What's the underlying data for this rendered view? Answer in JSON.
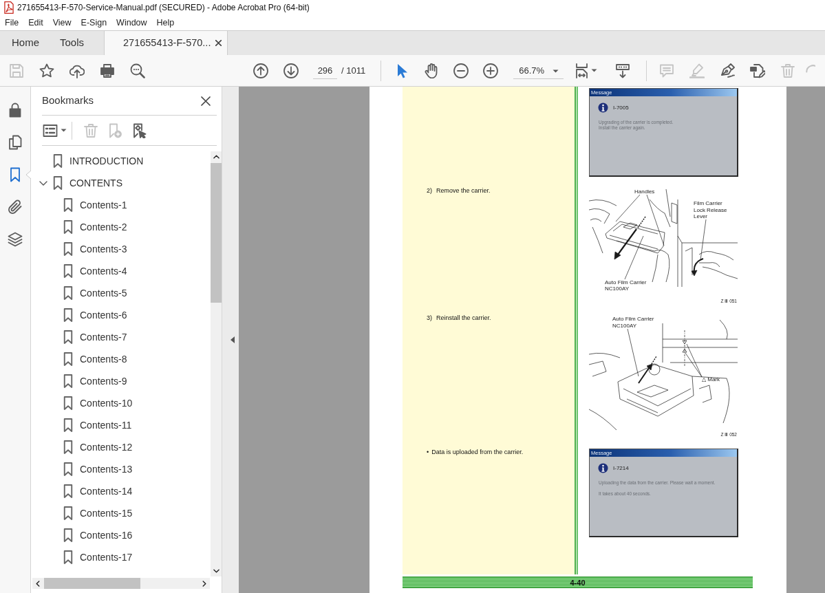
{
  "window": {
    "title": "271655413-F-570-Service-Manual.pdf (SECURED) - Adobe Acrobat Pro (64-bit)"
  },
  "menu": [
    "File",
    "Edit",
    "View",
    "E-Sign",
    "Window",
    "Help"
  ],
  "tabs": [
    {
      "label": "Home",
      "selected": false,
      "closable": false
    },
    {
      "label": "Tools",
      "selected": false,
      "closable": false
    },
    {
      "label": "271655413-F-570...",
      "selected": true,
      "closable": true
    }
  ],
  "toolbar": {
    "file_tools": [
      {
        "kind": "save",
        "disabled": true
      },
      {
        "kind": "star",
        "disabled": false
      },
      {
        "kind": "upload",
        "disabled": false
      },
      {
        "kind": "print",
        "disabled": false
      },
      {
        "kind": "find",
        "disabled": false
      }
    ],
    "page_tools": [
      {
        "kind": "previous"
      },
      {
        "kind": "next"
      }
    ],
    "page_number": "296",
    "page_count": "/ 1011",
    "mode_tools": [
      {
        "kind": "select",
        "selected": true
      },
      {
        "kind": "hand",
        "selected": false
      }
    ],
    "zoom_tools": [
      {
        "kind": "zoom-out"
      },
      {
        "kind": "zoom-in"
      }
    ],
    "zoom": "66.7%",
    "view_tools": [
      {
        "kind": "fit-page"
      },
      {
        "kind": "scroll-mode"
      }
    ],
    "edit_tools": [
      {
        "kind": "comment",
        "disabled": true
      },
      {
        "kind": "highlight",
        "disabled": true
      },
      {
        "kind": "sign",
        "disabled": false
      },
      {
        "kind": "edit-pdf",
        "disabled": false
      },
      {
        "kind": "delete",
        "disabled": true
      },
      {
        "kind": "redo",
        "disabled": true
      }
    ]
  },
  "sidebar": {
    "tools": [
      {
        "kind": "security",
        "selected": false
      },
      {
        "kind": "pages",
        "selected": false
      },
      {
        "kind": "bookmarks",
        "selected": true
      },
      {
        "kind": "attachments",
        "selected": false
      },
      {
        "kind": "layers",
        "selected": false
      }
    ]
  },
  "bookmarks": {
    "title": "Bookmarks",
    "tools": [
      {
        "kind": "options",
        "disabled": false
      },
      {
        "kind": "delete",
        "disabled": true
      },
      {
        "kind": "new",
        "disabled": true
      },
      {
        "kind": "find",
        "disabled": false
      }
    ],
    "items": [
      {
        "label": "INTRODUCTION"
      },
      {
        "label": "CONTENTS",
        "expanded": true,
        "children": [
          {
            "label": "Contents-1"
          },
          {
            "label": "Contents-2"
          },
          {
            "label": "Contents-3"
          },
          {
            "label": "Contents-4"
          },
          {
            "label": "Contents-5"
          },
          {
            "label": "Contents-6"
          },
          {
            "label": "Contents-7"
          },
          {
            "label": "Contents-8"
          },
          {
            "label": "Contents-9"
          },
          {
            "label": "Contents-10"
          },
          {
            "label": "Contents-11"
          },
          {
            "label": "Contents-12"
          },
          {
            "label": "Contents-13"
          },
          {
            "label": "Contents-14"
          },
          {
            "label": "Contents-15"
          },
          {
            "label": "Contents-16"
          },
          {
            "label": "Contents-17"
          }
        ]
      }
    ]
  },
  "page": {
    "sections": [
      {
        "figure": {
          "kind": "message",
          "title": "Message",
          "code": "I-7005",
          "lines": [
            "Upgrading of the carrier is completed.",
            "Install the carrier again."
          ]
        }
      },
      {
        "step": {
          "marker": "2)",
          "text": "Remove the carrier."
        },
        "figure": {
          "kind": "removal",
          "labels": [
            {
              "lines": [
                "Handles"
              ]
            },
            {
              "lines": [
                "Film Carrier",
                "Lock Release",
                "Lever"
              ]
            },
            {
              "lines": [
                "Auto Film Carrier",
                "NC100AY"
              ]
            }
          ],
          "caption": "Z Ⅲ 051"
        }
      },
      {
        "step": {
          "marker": "3)",
          "text": "Reinstall the carrier."
        },
        "figure": {
          "kind": "installation",
          "labels": [
            {
              "lines": [
                "Auto Film Carrier",
                "NC100AY"
              ]
            },
            {
              "lines": [
                "△ Mark"
              ]
            }
          ],
          "caption": "Z Ⅲ 052"
        }
      },
      {
        "step": {
          "marker": "•",
          "text": "Data is uploaded from the carrier."
        },
        "figure": {
          "kind": "message",
          "title": "Message",
          "code": "I-7214",
          "lines": [
            "Uploading the data from the carrier. Please wait a moment.",
            "It takes about 40 seconds."
          ]
        }
      }
    ],
    "footer": "4-40"
  }
}
